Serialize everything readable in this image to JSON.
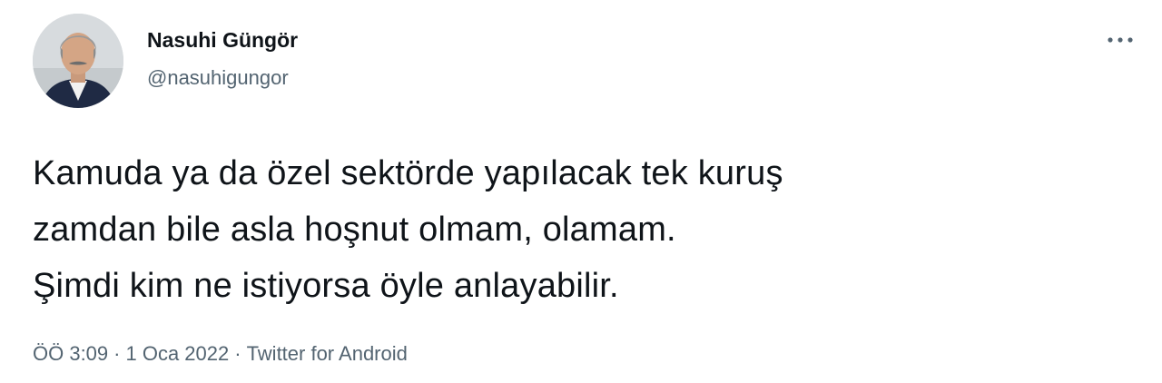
{
  "author": {
    "display_name": "Nasuhi Güngör",
    "handle": "@nasuhigungor"
  },
  "tweet": {
    "lines": [
      "Kamuda ya da özel sektörde yapılacak tek kuruş",
      "zamdan bile asla hoşnut olmam, olamam.",
      "Şimdi kim ne istiyorsa öyle anlayabilir."
    ]
  },
  "meta": {
    "time": "ÖÖ 3:09",
    "separator": "·",
    "date": "1 Oca 2022",
    "source": "Twitter for Android"
  },
  "icons": {
    "more": "more-horizontal-icon",
    "avatar": "profile-photo"
  },
  "colors": {
    "text_primary": "#0f1419",
    "text_secondary": "#536471",
    "background": "#ffffff"
  }
}
